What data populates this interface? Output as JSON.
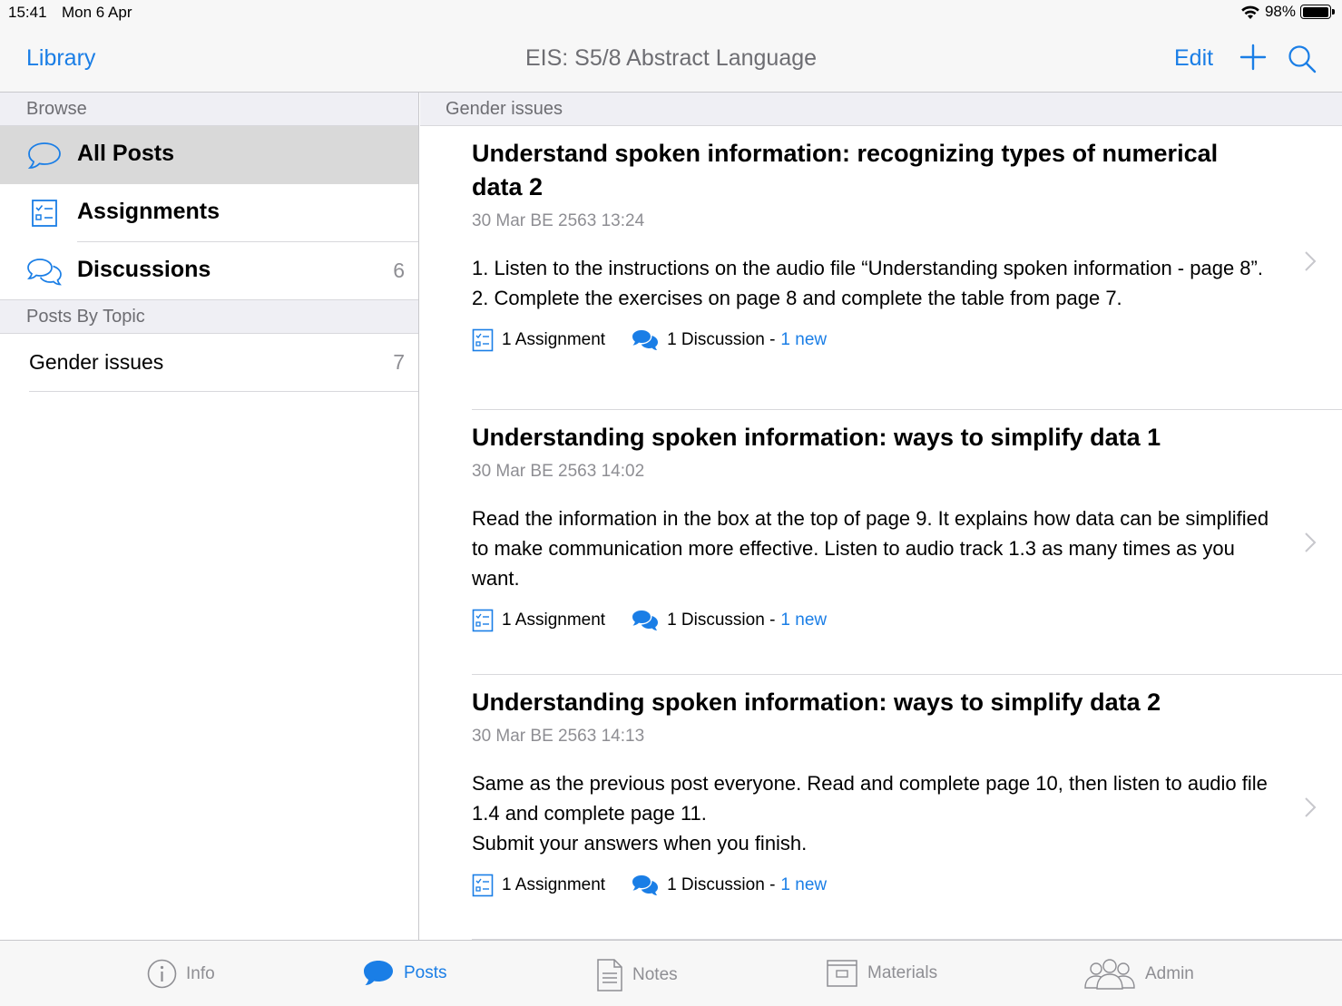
{
  "status": {
    "time": "15:41",
    "date": "Mon 6 Apr",
    "battery": "98%",
    "battery_level": 0.98
  },
  "nav": {
    "back_label": "Library",
    "title": "EIS: S5/8 Abstract Language",
    "edit_label": "Edit"
  },
  "sidebar": {
    "browse_header": "Browse",
    "items": [
      {
        "label": "All Posts",
        "count": "",
        "icon": "speech-bubble-icon",
        "selected": true
      },
      {
        "label": "Assignments",
        "count": "",
        "icon": "checklist-icon",
        "selected": false
      },
      {
        "label": "Discussions",
        "count": "6",
        "icon": "chat-bubbles-icon",
        "selected": false
      }
    ],
    "topics_header": "Posts By Topic",
    "topics": [
      {
        "label": "Gender issues",
        "count": "7"
      }
    ]
  },
  "main": {
    "header": "Gender issues",
    "posts": [
      {
        "title": "Understand spoken information: recognizing types of numerical data 2",
        "date": "30 Mar BE 2563 13:24",
        "body": [
          "1. Listen to the instructions on the audio file “Understanding spoken information - page 8”.",
          "2. Complete the exercises on page 8 and complete the table from page 7."
        ],
        "assignments": "1 Assignment",
        "discussions": "1 Discussion -",
        "new": "1 new"
      },
      {
        "title": "Understanding spoken information: ways to simplify data 1",
        "date": "30 Mar BE 2563 14:02",
        "body": [
          "Read the information in the box at the top of page 9. It explains how data can be simplified to make communication more effective. Listen to audio track 1.3 as many times as you want."
        ],
        "assignments": "1 Assignment",
        "discussions": "1 Discussion -",
        "new": "1 new"
      },
      {
        "title": "Understanding spoken information: ways to simplify data 2",
        "date": "30 Mar BE 2563 14:13",
        "body": [
          "Same as the previous post everyone. Read and complete page 10, then listen to audio file 1.4 and complete page 11.",
          "Submit your answers when you finish."
        ],
        "assignments": "1 Assignment",
        "discussions": "1 Discussion -",
        "new": "1 new"
      }
    ]
  },
  "tabs": [
    {
      "label": "Info",
      "icon": "info-icon",
      "active": false
    },
    {
      "label": "Posts",
      "icon": "posts-bubble-icon",
      "active": true
    },
    {
      "label": "Notes",
      "icon": "notes-icon",
      "active": false
    },
    {
      "label": "Materials",
      "icon": "materials-icon",
      "active": false
    },
    {
      "label": "Admin",
      "icon": "admin-users-icon",
      "active": false
    }
  ],
  "colors": {
    "accent": "#1a7ee6",
    "secondary_text": "#8e8e93",
    "section_bg": "#efeff4",
    "selected_bg": "#d9d9d9"
  }
}
